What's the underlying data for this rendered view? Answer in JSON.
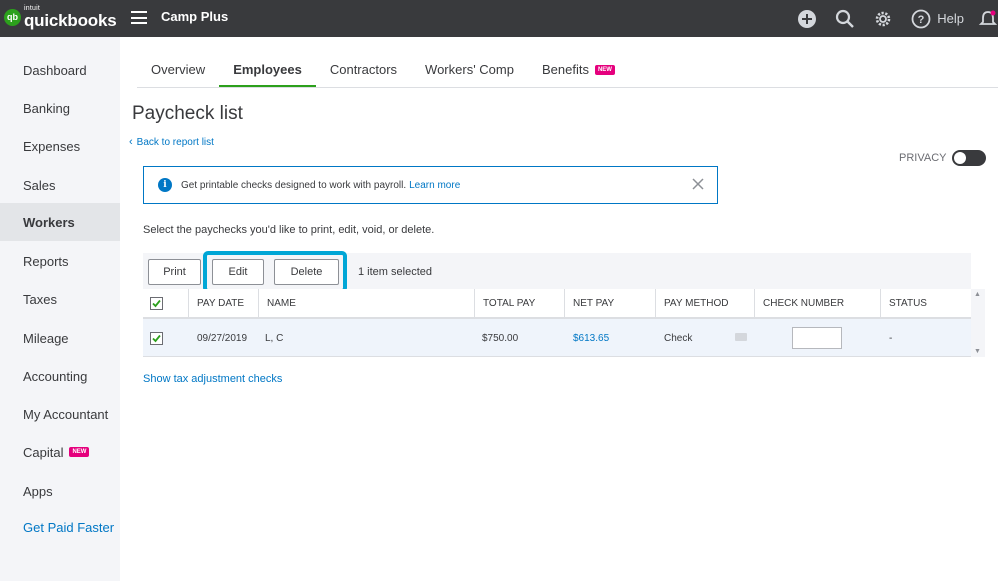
{
  "app": {
    "logo_intuit": "intuit",
    "logo_word": "quickbooks",
    "logo_mark": "qb",
    "company_name": "Camp Plus",
    "help_label": "Help"
  },
  "sidebar": {
    "items": [
      {
        "label": "Dashboard"
      },
      {
        "label": "Banking"
      },
      {
        "label": "Expenses"
      },
      {
        "label": "Sales"
      },
      {
        "label": "Workers",
        "active": true
      },
      {
        "label": "Reports"
      },
      {
        "label": "Taxes"
      },
      {
        "label": "Mileage"
      },
      {
        "label": "Accounting"
      },
      {
        "label": "My Accountant"
      },
      {
        "label": "Capital",
        "badge": "NEW"
      },
      {
        "label": "Apps"
      },
      {
        "label": "Get Paid Faster"
      }
    ]
  },
  "tabs": [
    {
      "label": "Overview"
    },
    {
      "label": "Employees",
      "active": true
    },
    {
      "label": "Contractors"
    },
    {
      "label": "Workers' Comp"
    },
    {
      "label": "Benefits",
      "badge": "NEW"
    }
  ],
  "page": {
    "title": "Paycheck list",
    "back_link": "Back to report list",
    "privacy_label": "PRIVACY",
    "banner_text": "Get printable checks designed to work with payroll.",
    "banner_link": "Learn more",
    "instructions": "Select the paychecks you'd like to print, edit, void, or delete.",
    "selected_count": "1 item selected",
    "tax_link": "Show tax adjustment checks"
  },
  "toolbar": {
    "print_label": "Print",
    "edit_label": "Edit",
    "delete_label": "Delete"
  },
  "table": {
    "headers": {
      "pay_date": "PAY DATE",
      "name": "NAME",
      "total_pay": "TOTAL PAY",
      "net_pay": "NET PAY",
      "pay_method": "PAY METHOD",
      "check_number": "CHECK NUMBER",
      "status": "STATUS"
    },
    "rows": [
      {
        "checked": true,
        "pay_date": "09/27/2019",
        "name": "L, C",
        "total_pay": "$750.00",
        "net_pay": "$613.65",
        "pay_method": "Check",
        "check_number": "",
        "status": "-"
      }
    ]
  },
  "colors": {
    "topbar": "#393a3d",
    "brand_green": "#2ca01c",
    "link_blue": "#0077c5",
    "highlight_cyan": "#00a6d6",
    "new_badge": "#e5007d"
  }
}
